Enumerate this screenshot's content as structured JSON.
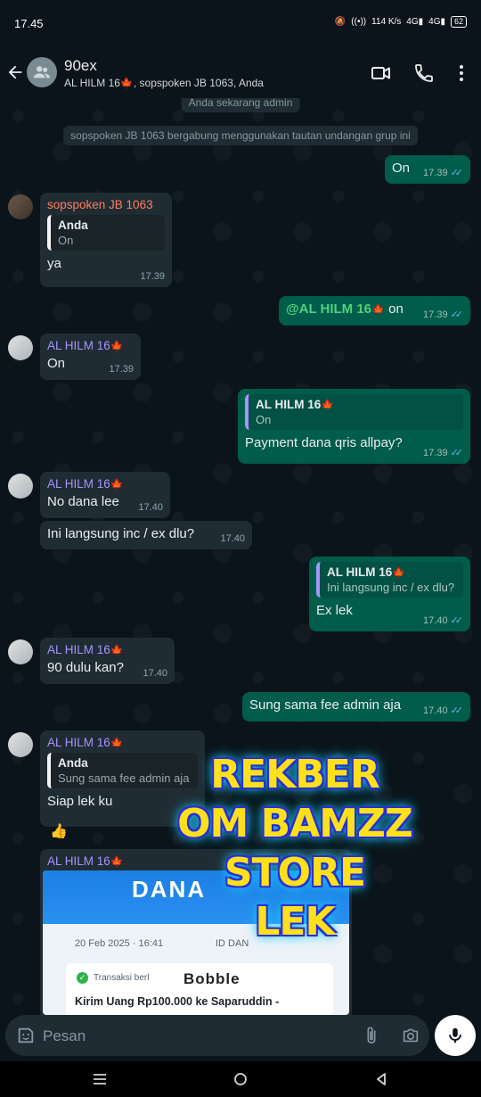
{
  "status": {
    "time": "17.45",
    "speed": "114 K/s",
    "battery": "62"
  },
  "header": {
    "title": "90ex",
    "subtitle": "AL HILM 16🍁, sopspoken JB 1063, Anda"
  },
  "system": {
    "admin": "Anda sekarang admin",
    "joined": "sopspoken JB 1063 bergabung menggunakan tautan undangan grup ini"
  },
  "messages": {
    "m1": {
      "text": "On",
      "time": "17.39"
    },
    "m2": {
      "sender": "sopspoken JB 1063",
      "quote_name": "Anda",
      "quote_text": "On",
      "text": "ya",
      "time": "17.39"
    },
    "m3": {
      "mention": "@AL HILM 16",
      "text": "on",
      "time": "17.39"
    },
    "m4": {
      "sender": "AL HILM 16",
      "text": "On",
      "time": "17.39"
    },
    "m5": {
      "quote_name": "AL HILM 16",
      "quote_text": "On",
      "text": "Payment dana qris allpay?",
      "time": "17.39"
    },
    "m6": {
      "sender": "AL HILM 16",
      "text": "No dana lee",
      "time": "17.40"
    },
    "m7": {
      "text": "Ini langsung inc / ex dlu?",
      "time": "17.40"
    },
    "m8": {
      "quote_name": "AL HILM 16",
      "quote_text": "Ini langsung inc / ex dlu?",
      "text": "Ex lek",
      "time": "17.40"
    },
    "m9": {
      "sender": "AL HILM 16",
      "text": "90 dulu kan?",
      "time": "17.40"
    },
    "m10": {
      "text": "Sung sama fee admin aja",
      "time": "17.40"
    },
    "m11": {
      "sender": "AL HILM 16",
      "quote_name": "Anda",
      "quote_text": "Sung sama fee admin aja",
      "text": "Siap lek ku",
      "reaction": "👍"
    },
    "m12": {
      "sender": "AL HILM 16",
      "image": {
        "logo": "DANA",
        "date": "20 Feb 2025 · 16:41",
        "id_label": "ID DAN",
        "status": "Transaksi berl",
        "watermark": "Bobble",
        "send": "Kirim Uang Rp100.000 ke Saparuddin -"
      }
    }
  },
  "overlay": {
    "line1": "REKBER",
    "line2": "OM BAMZZ",
    "line3": "STORE",
    "line4": "LEK"
  },
  "input": {
    "placeholder": "Pesan"
  },
  "icons": {
    "back": "back-arrow-icon",
    "video": "video-call-icon",
    "call": "phone-icon",
    "menu": "more-vert-icon",
    "emoji": "sticker-icon",
    "attach": "paperclip-icon",
    "camera": "camera-icon",
    "mic": "mic-icon"
  }
}
